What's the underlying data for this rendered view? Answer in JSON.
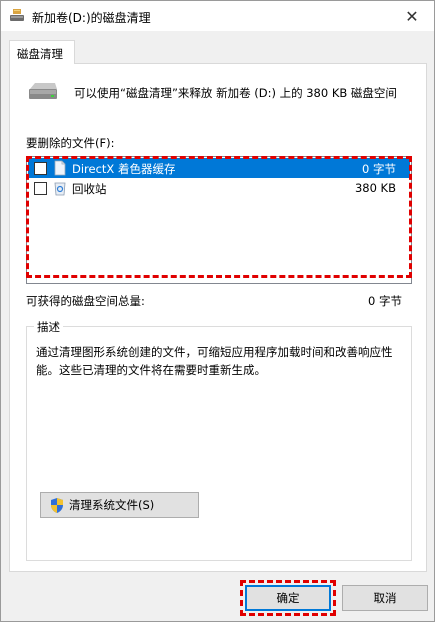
{
  "window": {
    "title": "新加卷(D:)的磁盘清理",
    "close_glyph": "✕"
  },
  "tab": {
    "label": "磁盘清理"
  },
  "header": {
    "text": "可以使用“磁盘清理”来释放 新加卷 (D:) 上的 380 KB 磁盘空间"
  },
  "files": {
    "label": "要删除的文件(F):",
    "items": [
      {
        "name": "DirectX 着色器缓存",
        "size": "0 字节",
        "checked": false,
        "selected": true
      },
      {
        "name": "回收站",
        "size": "380 KB",
        "checked": false,
        "selected": false
      }
    ]
  },
  "space": {
    "label": "可获得的磁盘空间总量:",
    "value": "0 字节"
  },
  "description": {
    "legend": "描述",
    "text": "通过清理图形系统创建的文件，可缩短应用程序加载时间和改善响应性能。这些已清理的文件将在需要时重新生成。"
  },
  "buttons": {
    "cleanup_system": "清理系统文件(S)",
    "ok": "确定",
    "cancel": "取消"
  },
  "colors": {
    "selection": "#0078d7",
    "annotation": "#e00000"
  },
  "icons": {
    "title": "disk-cleanup-icon",
    "drive": "drive-icon",
    "file": "file-icon",
    "recycle": "recycle-bin-icon",
    "shield": "uac-shield-icon"
  }
}
